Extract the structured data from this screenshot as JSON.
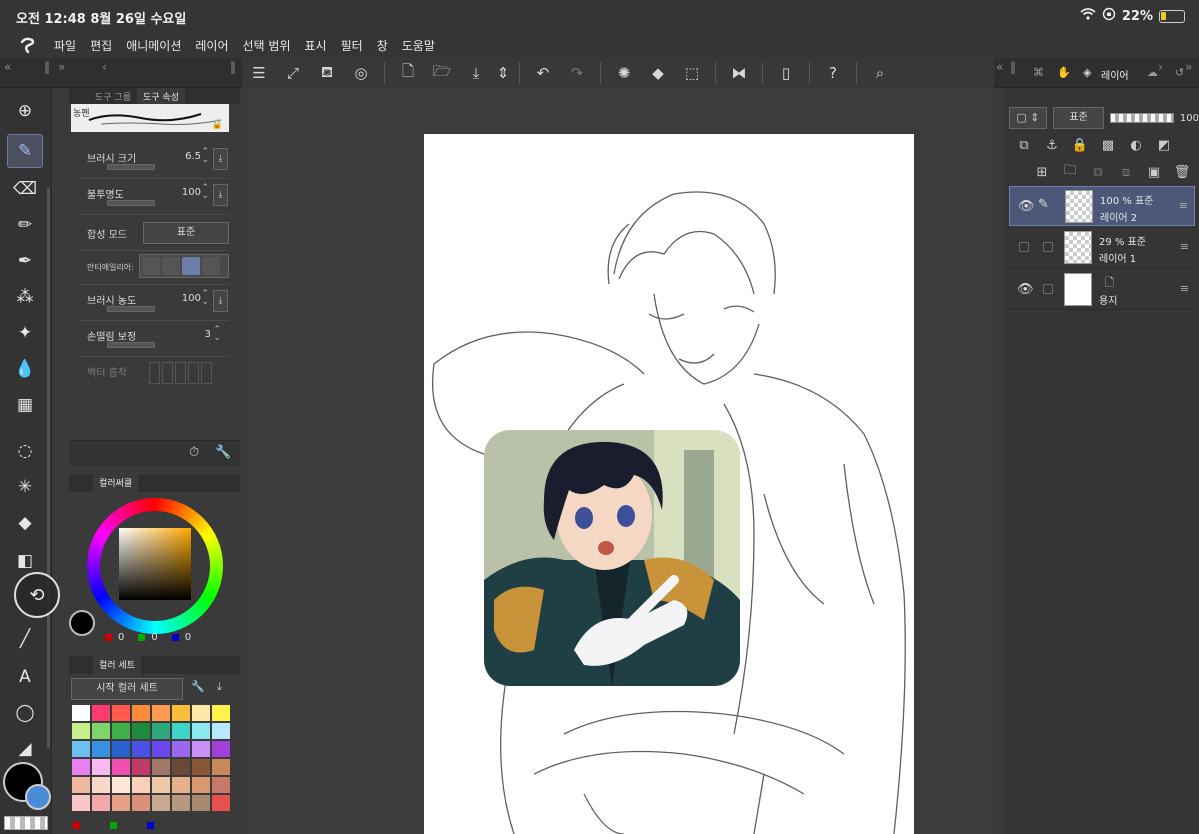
{
  "status": {
    "time_date": "오전 12:48   8월 26일 수요일",
    "battery": "22%",
    "battery_level": 0.22
  },
  "menu": {
    "logo": "C",
    "items": [
      "파일",
      "편집",
      "애니메이션",
      "레이어",
      "선택 범위",
      "표시",
      "필터",
      "창",
      "도움말"
    ]
  },
  "tool_panel": {
    "tabs": [
      "도구 그룹",
      "도구 속성"
    ],
    "brush_name": "농펜",
    "props": {
      "brush_size": {
        "label": "브러시 크기",
        "value": "6.5"
      },
      "opacity": {
        "label": "불투명도",
        "value": "100"
      },
      "blend_mode": {
        "label": "합성 모드",
        "value": "표준"
      },
      "antialias": {
        "label": "안티에일리어:"
      },
      "brush_density": {
        "label": "브러시 농도",
        "value": "100"
      },
      "stabilizer": {
        "label": "손떨림 보정",
        "value": "3"
      },
      "vector": {
        "label": "벡터 흡착"
      }
    }
  },
  "color_wheel": {
    "tab": "컬러써클",
    "r": "0",
    "g": "0",
    "b": "0"
  },
  "color_set": {
    "tab": "컬러 세트",
    "selected": "시작 컬러 세트",
    "swatches": [
      "#ffffff",
      "#ff3b6b",
      "#ff5a4a",
      "#ff8a3a",
      "#ff9a50",
      "#ffbe3a",
      "#ffe8a8",
      "#fff24a",
      "#c8f08a",
      "#7ed56a",
      "#3fb04a",
      "#1e8a3c",
      "#2ea87a",
      "#3fd4c8",
      "#8ae8f0",
      "#b8e8ff",
      "#6ac0f0",
      "#3a90e0",
      "#2a60d0",
      "#4a50e8",
      "#6a48f0",
      "#9a68f0",
      "#c890f8",
      "#a040d8",
      "#e880f0",
      "#f8b8f0",
      "#f050b0",
      "#c03a6a",
      "#a0786a",
      "#6a4838",
      "#8a5838",
      "#c88858",
      "#f0b8a0",
      "#f8d8c8",
      "#ffe8d8",
      "#f8d0b8",
      "#f0c8a8",
      "#e8b088",
      "#d89870",
      "#c87868",
      "#f8c8c8",
      "#f0a8a8",
      "#e8a088",
      "#d89078",
      "#c8a890",
      "#b89880",
      "#a88870",
      "#e85050"
    ]
  },
  "toolbar_icons": [
    "menu-icon",
    "resize-icon",
    "paint-bucket-icon",
    "spiral-icon",
    "new-file-icon",
    "open-folder-icon",
    "save-icon",
    "undo-icon",
    "redo-icon",
    "spinner-icon",
    "fill-icon",
    "transform-icon",
    "flip-icon",
    "phone-icon",
    "help-icon",
    "search-doc-icon"
  ],
  "layers": {
    "tab": "레이어",
    "blend": "표준",
    "opacity": "100",
    "list": [
      {
        "name": "레이어 2",
        "info": "100 %  표준",
        "visible": true,
        "selected": true
      },
      {
        "name": "레이어 1",
        "info": "29 %  표준",
        "visible": false,
        "selected": false
      },
      {
        "name": "용지",
        "info": "",
        "visible": true,
        "selected": false
      }
    ]
  },
  "colors": {
    "main": "#000000",
    "sub": "#4a8cd8",
    "accent": "#6c79a6"
  }
}
